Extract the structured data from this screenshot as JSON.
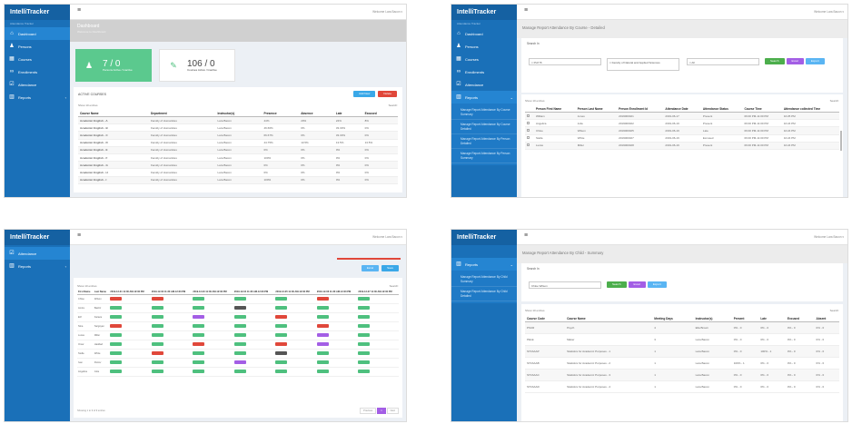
{
  "brand": "IntelliTracker",
  "brand_sub": "Attendance Tracker",
  "welcome": "Welcome Lara Bacon ▾",
  "hamburger": "≡",
  "nav": {
    "dashboard": "Dashboard",
    "persons": "Persons",
    "courses": "Courses",
    "enrollments": "Enrollments",
    "attendance": "Attendance",
    "reports": "Reports"
  },
  "report_links": [
    "Manage Report Attendance By Course Summary",
    "Manage Report Attendance By Course Detailed",
    "Manage Report Attendance By Person Detailed",
    "Manage Report Attendance By Person Summary"
  ],
  "report_links_p4": [
    "Manage Report Attendance By Child Summary",
    "Manage Report Attendance By Child Detailed"
  ],
  "p1": {
    "title": "Dashboard",
    "subtitle": "Welcome to Dashboard",
    "card1_num": "7 / 0",
    "card1_label": "Persons Active / Inactive",
    "card2_num": "106 / 0",
    "card2_label": "Courses Active / Inactive",
    "box_title": "ACTIVE COURSES",
    "btn_add": "Add New",
    "btn_delete": "Delete",
    "show": "Show  10  entries",
    "search": "Search:",
    "headers": [
      "Course Name",
      "Department",
      "Instructor(s)",
      "Presence",
      "Absence",
      "Late",
      "Excused"
    ],
    "rows": [
      [
        "Academic English - A",
        "Faculty of Humanities",
        "Lara Bacon",
        "44%",
        "20%",
        "24%",
        "8%"
      ],
      [
        "Academic English - B",
        "Faculty of Humanities",
        "Lara Bacon",
        "46.66%",
        "0%",
        "33.33%",
        "0%"
      ],
      [
        "Academic English - C",
        "Faculty of Humanities",
        "Lara Bacon",
        "66.67%",
        "0%",
        "33.33%",
        "0%"
      ],
      [
        "Academic English - D",
        "Faculty of Humanities",
        "Lara Bacon",
        "44.75%",
        "13.5%",
        "13.5%",
        "13.5%"
      ],
      [
        "Academic English - E",
        "Faculty of Humanities",
        "Lara Bacon",
        "0%",
        "0%",
        "0%",
        "0%"
      ],
      [
        "Academic English - F",
        "Faculty of Humanities",
        "Lara Bacon",
        "100%",
        "0%",
        "0%",
        "0%"
      ],
      [
        "Academic English - G",
        "Faculty of Humanities",
        "Lara Bacon",
        "0%",
        "0%",
        "0%",
        "0%"
      ],
      [
        "Academic English - H",
        "Faculty of Humanities",
        "Lara Bacon",
        "0%",
        "0%",
        "0%",
        "0%"
      ],
      [
        "Academic English - I",
        "Faculty of Humanities",
        "Lara Bacon",
        "100%",
        "0%",
        "0%",
        "0%"
      ]
    ]
  },
  "p2": {
    "title": "Manage Report Attendance By Course - Detailed",
    "filter_title": "Search In",
    "sel_course": "× PHY B",
    "sel_faculty": "× Faculty of Natural and Applied Sciences",
    "sel_all": "× All",
    "btn_search": "Search",
    "btn_excel": "Excel",
    "btn_export": "Export",
    "show": "Show  10  entries",
    "search": "Search:",
    "headers": [
      "",
      "Person First Name",
      "Person Last Name",
      "Person Enrollment Id",
      "Attendance Date",
      "Attendance Status",
      "Course Time",
      "Attendance collected Time"
    ],
    "rows": [
      [
        "",
        "William",
        "Jones",
        "2019000021",
        "2019-06-17",
        "Present",
        "06:00 PM-11:00 PM",
        "10:25 PM"
      ],
      [
        "",
        "Angelica",
        "Jolie",
        "2019000022",
        "2019-06-19",
        "Present",
        "06:00 PM-11:00 PM",
        "10:24 PM"
      ],
      [
        "",
        "Chloe",
        "Wilson",
        "2019000025",
        "2019-06-19",
        "Late",
        "06:00 PM-11:00 PM",
        "10:24 PM"
      ],
      [
        "",
        "Stella",
        "White",
        "2019000027",
        "2019-06-19",
        "Excused",
        "06:00 PM-11:00 PM",
        "10:24 PM"
      ],
      [
        "",
        "Lucas",
        "Miller",
        "2019000028",
        "2019-06-19",
        "Present",
        "06:00 PM-11:00 PM",
        "10:24 PM"
      ]
    ]
  },
  "p3": {
    "btn_excel": "Excel",
    "btn_save": "Save",
    "show": "Show  10  entries",
    "search": "Search:",
    "headers": [
      "First Name",
      "Last Name",
      "2019-12-01 11:30 AM-12:30 PM",
      "2019-12-02 11:30 AM-12:30 PM",
      "2019-12-03 11:30 AM-12:30 PM",
      "2019-12-04 11:30 AM-12:30 PM",
      "2019-12-05 11:30 AM-12:30 PM",
      "2019-12-06 11:30 AM-12:30 PM",
      "2019-12-07 11:30 AM-12:30 PM"
    ],
    "rows": [
      {
        "first": "Chloe",
        "last": "Wilson",
        "marks": [
          "A",
          "A",
          "P",
          "P",
          "P",
          "A",
          "P"
        ]
      },
      {
        "first": "Amira",
        "last": "Bashir",
        "marks": [
          "P",
          "P",
          "P",
          "E",
          "P",
          "P",
          "P"
        ]
      },
      {
        "first": "Elif",
        "last": "Karaca",
        "marks": [
          "P",
          "P",
          "L",
          "P",
          "A",
          "P",
          "P"
        ]
      },
      {
        "first": "Nina",
        "last": "Sargsyan",
        "marks": [
          "A",
          "P",
          "P",
          "P",
          "P",
          "A",
          "P"
        ]
      },
      {
        "first": "Lucas",
        "last": "Miller",
        "marks": [
          "P",
          "P",
          "P",
          "P",
          "P",
          "L",
          "P"
        ]
      },
      {
        "first": "Omar",
        "last": "Haddad",
        "marks": [
          "P",
          "P",
          "A",
          "P",
          "A",
          "L",
          "P"
        ]
      },
      {
        "first": "Stella",
        "last": "White",
        "marks": [
          "P",
          "A",
          "P",
          "P",
          "E",
          "P",
          "P"
        ]
      },
      {
        "first": "Ivan",
        "last": "Petrov",
        "marks": [
          "P",
          "P",
          "P",
          "L",
          "P",
          "P",
          "P"
        ]
      },
      {
        "first": "Angelica",
        "last": "Jolie",
        "marks": [
          "P",
          "P",
          "P",
          "P",
          "P",
          "P",
          "P"
        ]
      }
    ],
    "footer": "Showing 1 to 9 of 9 entries",
    "prev": "Previous",
    "page": "1",
    "next": "Next"
  },
  "p4": {
    "title": "Manage Report Attendance By Child - Summary",
    "filter_title": "Search In",
    "sel_child": "Chloe Wilson",
    "btn_search": "Search",
    "btn_excel": "Excel",
    "btn_export": "Export",
    "show": "Show  10  entries",
    "search": "Search:",
    "headers": [
      "Course Code",
      "Course Name",
      "Meeting Days",
      "Instructor(s)",
      "Present",
      "Late",
      "Excused",
      "Absent"
    ],
    "rows": [
      [
        "PSUR",
        "Psych",
        "4",
        "Ella Brown",
        "0% - 0",
        "0% - 0",
        "0% - 0",
        "0% - 0"
      ],
      [
        "PELE",
        "Maker",
        "3",
        "Lara Bacon",
        "0% - 0",
        "0% - 0",
        "0% - 0",
        "0% - 0"
      ],
      [
        "STASAAP",
        "Statistics for Academic Purposes - 1",
        "1",
        "Lara Bacon",
        "0% - 0",
        "100% - 1",
        "0% - 0",
        "0% - 0"
      ],
      [
        "STASAAB",
        "Statistics for Academic Purposes - 2",
        "1",
        "Lara Bacon",
        "100% - 1",
        "0% - 0",
        "0% - 0",
        "0% - 0"
      ],
      [
        "STASAAC",
        "Statistics for Academic Purposes - 3",
        "1",
        "Lara Bacon",
        "0% - 0",
        "0% - 0",
        "0% - 0",
        "0% - 0"
      ],
      [
        "STASAAD",
        "Statistics for Academic Purposes - 4",
        "1",
        "Lara Bacon",
        "0% - 0",
        "0% - 0",
        "0% - 0",
        "0% - 0"
      ]
    ]
  }
}
